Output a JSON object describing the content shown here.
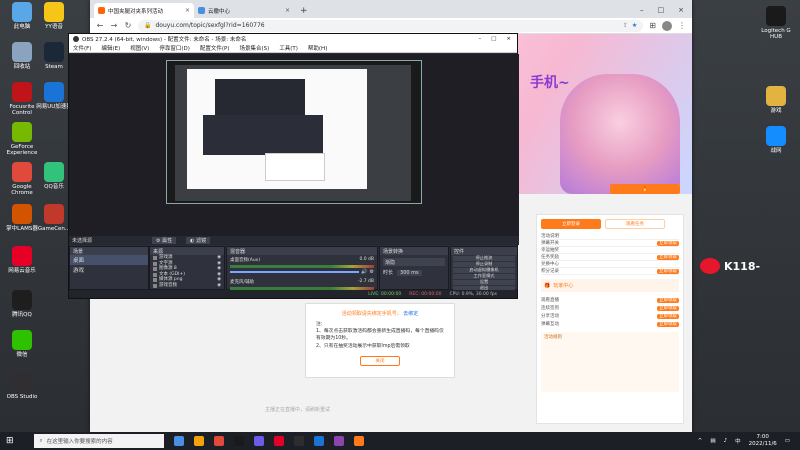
{
  "desktop": {
    "left_icons": [
      {
        "label": "此电脑",
        "icon": "computer-icon",
        "color": "#5aa7e8"
      },
      {
        "label": "YY语音",
        "icon": "yy-icon",
        "color": "#f5c518"
      },
      {
        "label": "回收站",
        "icon": "recycle-bin-icon",
        "color": "#8aa4bf"
      },
      {
        "label": "Steam",
        "icon": "steam-icon",
        "color": "#1b2838"
      },
      {
        "label": "Focusrite Control",
        "icon": "focusrite-icon",
        "color": "#c0141b"
      },
      {
        "label": "网易UU加速器",
        "icon": "uu-icon",
        "color": "#1a74d6"
      },
      {
        "label": "GeForce Experience",
        "icon": "geforce-icon",
        "color": "#76b900"
      },
      {
        "label": "Google Chrome",
        "icon": "chrome-icon",
        "color": "#e04a3b"
      },
      {
        "label": "QQ音乐",
        "icon": "qqmusic-icon",
        "color": "#31c27c"
      },
      {
        "label": "掌中LAMS器",
        "icon": "lams-icon",
        "color": "#d35400"
      },
      {
        "label": "GameCen...",
        "icon": "gamecenter-icon",
        "color": "#c0392b"
      },
      {
        "label": "网易云音乐",
        "icon": "netease-music-icon",
        "color": "#e60026"
      },
      {
        "label": "腾讯QQ",
        "icon": "qq-icon",
        "color": "#1e1e1e"
      },
      {
        "label": "微信",
        "icon": "wechat-icon",
        "color": "#2dc100"
      },
      {
        "label": "OBS Studio",
        "icon": "obs-icon",
        "color": "#302e31"
      }
    ],
    "right_icons": [
      {
        "label": "Logitech G HUB",
        "icon": "logitech-icon",
        "color": "#1a1a1a"
      },
      {
        "label": "游戏",
        "icon": "game-folder-icon",
        "color": "#e3b341"
      },
      {
        "label": "战网",
        "icon": "battlenet-icon",
        "color": "#148eff"
      }
    ],
    "weibo_watermark": "K118-"
  },
  "browser": {
    "tabs": [
      {
        "title": "中国夹腿对夹系列活动",
        "active": true
      },
      {
        "title": "云撒中心",
        "active": false
      }
    ],
    "new_tab": "+",
    "url": "douyu.com/topic/sexfgl?rid=160776"
  },
  "page": {
    "banner_text": "手机~",
    "sidebar": {
      "login_tab": "立即登录",
      "tab2": "观看任务",
      "rows": [
        "活动说明",
        "弹幕开关",
        "幸运抽奖",
        "任务奖励",
        "兑换中心",
        "积分记录"
      ],
      "btn": "立即领取",
      "section_title": "玩家中心",
      "list": [
        "观看直播",
        "连续签到",
        "分享活动",
        "弹幕互动"
      ],
      "claim": "立即领取",
      "rules_heading": "活动规则"
    },
    "modal": {
      "title": "活动领取请先绑定手机号，",
      "link": "去绑定",
      "note_label": "注:",
      "rule1": "1、每次点击获取激活码都会重新生成直播码，每个直播码仅有效期为10秒。",
      "rule2": "2、只有在抽奖活动展示中获取Imp后需领取",
      "close": "关闭"
    },
    "footer_hint": "主播正在直播中，请刷新重试"
  },
  "obs": {
    "title": "OBS 27.2.4 (64-bit, windows) - 配置文件: 未命名 - 场景: 未命名",
    "menu": [
      "文件(F)",
      "编辑(E)",
      "视图(V)",
      "停靠窗口(D)",
      "配置文件(P)",
      "场景集合(S)",
      "工具(T)",
      "帮助(H)"
    ],
    "no_source": "未选择源",
    "prop_btn": "属性",
    "filter_btn": "滤镜",
    "docks": {
      "scenes": "场景",
      "sources": "来源",
      "mixer": "混音器",
      "transitions": "场景转换",
      "controls": "控件"
    },
    "scenes": [
      "桌面",
      "游戏"
    ],
    "sources": [
      "游戏源",
      "文字源",
      "图像源 8",
      "文本 (GDI+)",
      "媒体源 png",
      "游戏音频"
    ],
    "mixer": [
      {
        "name": "桌面音频(Aux)",
        "db": "0.0 dB"
      },
      {
        "name": "麦克风/辅助",
        "db": "-2.7 dB"
      }
    ],
    "transition": {
      "type": "渐隐",
      "duration_label": "时长",
      "duration": "300 ms"
    },
    "controls": [
      "停止推流",
      "停止录制",
      "启动虚拟摄像机",
      "工作室模式",
      "设置",
      "退出"
    ],
    "status": {
      "live": "LIVE: 00:00:00",
      "rec": "REC: 00:00:00",
      "cpu": "CPU: 0.9%, 30.00 fps"
    }
  },
  "taskbar": {
    "search_placeholder": "在这里输入你要搜索的内容",
    "time": "7:00",
    "date": "2022/11/6",
    "lang": "中"
  },
  "colors": {
    "accent": "#ff7a1a",
    "obs_bg": "#2b2e38",
    "taskbar": "#1c1f25"
  }
}
